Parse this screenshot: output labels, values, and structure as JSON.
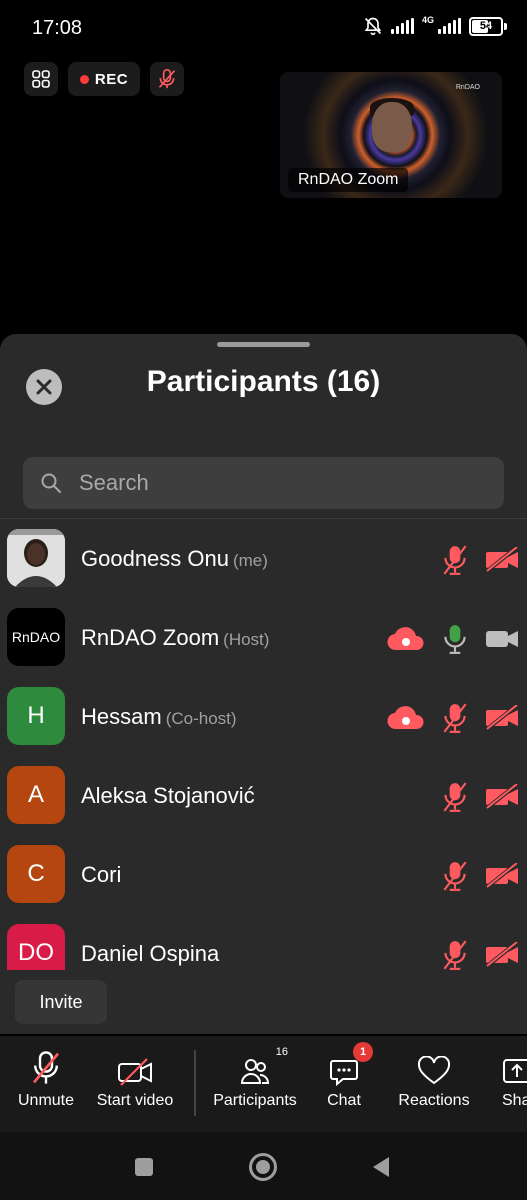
{
  "status_bar": {
    "time": "17:08",
    "network": "4G",
    "battery": "54"
  },
  "meeting": {
    "recording_label": "REC",
    "video_tile": {
      "name": "RnDAO Zoom",
      "logo": "RnDAO"
    }
  },
  "participants_panel": {
    "title": "Participants (16)",
    "search_placeholder": "Search",
    "participants": [
      {
        "name": "Goodness Onu",
        "role": "(me)",
        "avatar": "",
        "avatar_color": "#cfcfcf",
        "cloud": false,
        "mic": "muted",
        "camera": "off"
      },
      {
        "name": "RnDAO Zoom",
        "role": "(Host)",
        "avatar": "RnDAO",
        "avatar_color": "#000000",
        "cloud": true,
        "mic": "on",
        "camera": "on"
      },
      {
        "name": "Hessam",
        "role": "(Co-host)",
        "avatar": "H",
        "avatar_color": "#2e8b3e",
        "cloud": true,
        "mic": "muted",
        "camera": "off"
      },
      {
        "name": "Aleksa Stojanović",
        "role": "",
        "avatar": "A",
        "avatar_color": "#b5460f",
        "cloud": false,
        "mic": "muted",
        "camera": "off"
      },
      {
        "name": "Cori",
        "role": "",
        "avatar": "C",
        "avatar_color": "#b5460f",
        "cloud": false,
        "mic": "muted",
        "camera": "off"
      },
      {
        "name": "Daniel Ospina",
        "role": "",
        "avatar": "DO",
        "avatar_color": "#d81b47",
        "cloud": false,
        "mic": "muted",
        "camera": "off"
      }
    ],
    "invite_label": "Invite"
  },
  "toolbar": {
    "unmute": "Unmute",
    "start_video": "Start video",
    "participants": "Participants",
    "participants_count": "16",
    "chat": "Chat",
    "chat_badge": "1",
    "reactions": "Reactions",
    "share": "Sha"
  },
  "colors": {
    "muted_red": "#ff5a5f",
    "mic_green": "#43a047",
    "sheet_bg": "#2a2a2a"
  },
  "icons": {
    "close": "close-icon",
    "search": "search-icon",
    "cloud": "cloud-record-icon",
    "mic_muted": "mic-muted-icon",
    "mic": "mic-icon",
    "camera_off": "camera-off-icon",
    "camera": "camera-icon"
  }
}
